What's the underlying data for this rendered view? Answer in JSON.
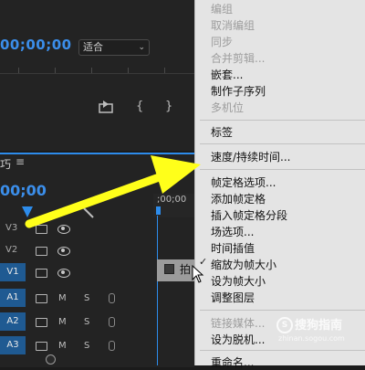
{
  "program_monitor": {
    "timecode": "00;00;00",
    "fit_dropdown_value": "适合",
    "icons": [
      "export-frame-icon",
      "mark-in-icon",
      "mark-out-icon"
    ],
    "mark_in_glyph": "{",
    "mark_out_glyph": "}"
  },
  "timeline": {
    "tab_title": "巧",
    "menu_glyph": "≡",
    "timecode": "00;00",
    "ruler_time": ";00;00",
    "video_tracks": [
      {
        "label": "V3",
        "selected": false
      },
      {
        "label": "V2",
        "selected": false
      },
      {
        "label": "V1",
        "selected": true
      }
    ],
    "audio_tracks": [
      {
        "label": "A1",
        "m": "M",
        "s": "S"
      },
      {
        "label": "A2",
        "m": "M",
        "s": "S"
      },
      {
        "label": "A3",
        "m": "M",
        "s": "S"
      }
    ],
    "clip_label": "拍"
  },
  "context_menu": {
    "items": [
      {
        "label": "编组",
        "enabled": false
      },
      {
        "label": "取消编组",
        "enabled": false
      },
      {
        "label": "同步",
        "enabled": false
      },
      {
        "label": "合并剪辑...",
        "enabled": false
      },
      {
        "label": "嵌套...",
        "enabled": true
      },
      {
        "label": "制作子序列",
        "enabled": true
      },
      {
        "label": "多机位",
        "enabled": false
      },
      {
        "label": "标签",
        "enabled": true
      },
      {
        "label": "速度/持续时间...",
        "enabled": true
      },
      {
        "label": "帧定格选项...",
        "enabled": true
      },
      {
        "label": "添加帧定格",
        "enabled": true
      },
      {
        "label": "插入帧定格分段",
        "enabled": true
      },
      {
        "label": "场选项...",
        "enabled": true
      },
      {
        "label": "时间插值",
        "enabled": true
      },
      {
        "label": "缩放为帧大小",
        "enabled": true,
        "checked": true
      },
      {
        "label": "设为帧大小",
        "enabled": true
      },
      {
        "label": "调整图层",
        "enabled": true
      },
      {
        "label": "链接媒体...",
        "enabled": false
      },
      {
        "label": "设为脱机...",
        "enabled": true
      },
      {
        "label": "重命名...",
        "enabled": true
      }
    ],
    "check_glyph": "✓"
  },
  "annotation": {
    "arrow_color": "#ffff1a"
  },
  "watermark": {
    "logo_glyph": "S",
    "text": "搜狗指南",
    "url": "zhinan.sogou.com"
  },
  "colors": {
    "accent": "#2d8ceb",
    "menu_bg": "#e4e4e4",
    "panel_bg": "#232323"
  }
}
